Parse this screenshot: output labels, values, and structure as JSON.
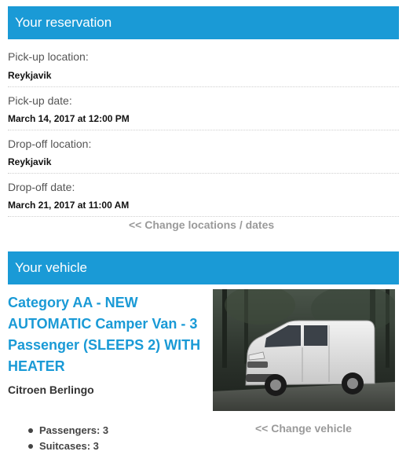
{
  "reservation": {
    "header": "Your reservation",
    "pickup_location_label": "Pick-up location:",
    "pickup_location_value": "Reykjavik",
    "pickup_date_label": "Pick-up date:",
    "pickup_date_value": "March 14, 2017 at 12:00 PM",
    "dropoff_location_label": "Drop-off location:",
    "dropoff_location_value": "Reykjavik",
    "dropoff_date_label": "Drop-off date:",
    "dropoff_date_value": "March 21, 2017 at 11:00 AM",
    "change_link": "<< Change locations / dates"
  },
  "vehicle": {
    "header": "Your vehicle",
    "title": "Category AA - NEW AUTOMATIC Camper Van - 3 Passenger (SLEEPS 2) WITH HEATER",
    "model": "Citroen Berlingo",
    "change_link": "<< Change vehicle",
    "specs": [
      "Passengers: 3",
      "Suitcases: 3"
    ]
  },
  "colors": {
    "accent": "#1a9ad6",
    "link": "#9a9a9a"
  }
}
